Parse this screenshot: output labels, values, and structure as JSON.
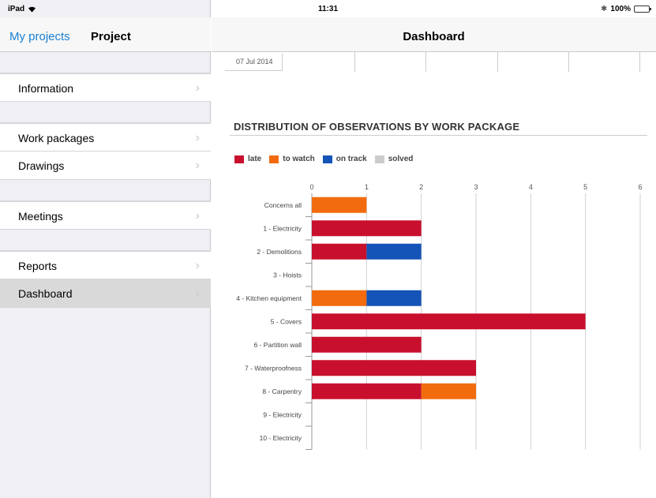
{
  "status_bar": {
    "device": "iPad",
    "time": "11:31",
    "battery": "100%"
  },
  "sidebar": {
    "back_label": "My projects",
    "title": "Project",
    "items": [
      {
        "label": "Information",
        "group": 0
      },
      {
        "label": "Work packages",
        "group": 1
      },
      {
        "label": "Drawings",
        "group": 1
      },
      {
        "label": "Meetings",
        "group": 2
      },
      {
        "label": "Reports",
        "group": 3
      },
      {
        "label": "Dashboard",
        "group": 3,
        "selected": true
      }
    ]
  },
  "main": {
    "title": "Dashboard",
    "date_tab": "07 Jul 2014"
  },
  "chart_data": {
    "type": "bar",
    "orientation": "horizontal",
    "stacked": true,
    "title": "DISTRIBUTION OF OBSERVATIONS BY WORK PACKAGE",
    "legend": [
      "late",
      "to watch",
      "on track",
      "solved"
    ],
    "legend_placement": "top-left",
    "colors": {
      "late": "#c8102e",
      "to watch": "#f26b0f",
      "on track": "#1454b8",
      "solved": "#cccccc"
    },
    "categories": [
      "Concerns all",
      "1 - Electricity",
      "2 - Demolitions",
      "3 - Hoists",
      "4 - Kitchen equipment",
      "5 - Covers",
      "6 - Partition wall",
      "7 - Waterproofness",
      "8 - Carpentry",
      "9 - Electricity",
      "10 - Electricity"
    ],
    "series": [
      {
        "name": "late",
        "values": [
          0,
          2,
          1,
          0,
          0,
          5,
          2,
          3,
          2,
          0,
          0
        ]
      },
      {
        "name": "to watch",
        "values": [
          1,
          0,
          0,
          0,
          1,
          0,
          0,
          0,
          1,
          0,
          0
        ]
      },
      {
        "name": "on track",
        "values": [
          0,
          0,
          1,
          0,
          1,
          0,
          0,
          0,
          0,
          0,
          0
        ]
      },
      {
        "name": "solved",
        "values": [
          0,
          0,
          0,
          0,
          0,
          0,
          0,
          0,
          0,
          0,
          0
        ]
      }
    ],
    "xlim": [
      0,
      6
    ],
    "xticks": [
      "0",
      "1",
      "2",
      "3",
      "4",
      "5",
      "6"
    ],
    "grid": true
  }
}
